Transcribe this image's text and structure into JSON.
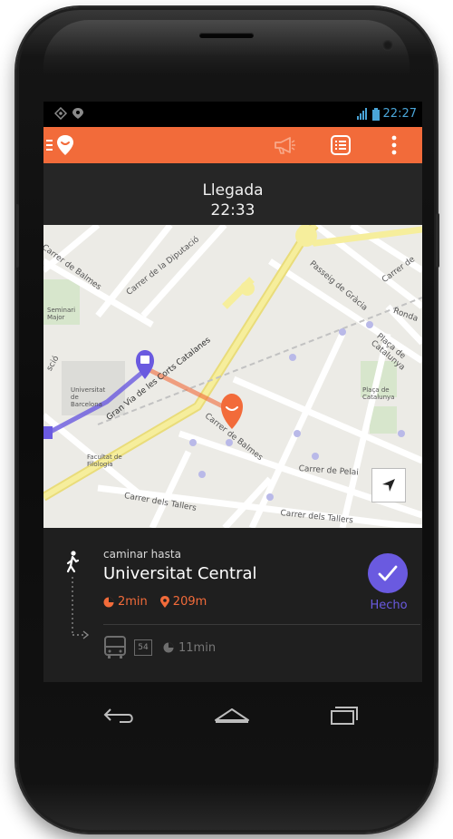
{
  "status_bar": {
    "time": "22:27"
  },
  "action_bar": {
    "menu_icon": "hamburger-icon",
    "logo_icon": "app-logo-icon",
    "megaphone_icon": "megaphone-icon",
    "list_icon": "list-view-icon",
    "overflow_icon": "overflow-menu-icon",
    "accent_color": "#f26b3a"
  },
  "arrival": {
    "label": "Llegada",
    "time": "22:33"
  },
  "map": {
    "streets": {
      "balmes_top": "Carrer de Balmes",
      "diputacio": "Carrer de la Diputació",
      "passeig_gracia": "Passeig de Gràcia",
      "carrer_de": "Carrer de",
      "ronda": "Ronda",
      "placa_catalunya": "Plaça de Catalunya",
      "placa_catalunya_small": "Plaça de Catalunya",
      "gran_via": "Gran Via de les Corts Catalanes",
      "balmes": "Carrer de Balmes",
      "pelai": "Carrer de Pelai",
      "tallers_1": "Carrer dels Tallers",
      "tallers_2": "Carrer dels Tallers",
      "seminari": "Seminari Major",
      "universitat": "Universitat de Barcelona",
      "facultat": "Facultat de Filologia",
      "partial_left": "sció",
      "universitat_2": "Universitat de Barcelona"
    },
    "route_color": "#6a5ae0",
    "walk_color": "#f26b3a"
  },
  "directions": {
    "walk_label": "caminar hasta",
    "destination": "Universitat Central",
    "walk_time": "2min",
    "walk_distance": "209m",
    "done_label": "Hecho",
    "next_route": "54",
    "next_time": "11min"
  }
}
